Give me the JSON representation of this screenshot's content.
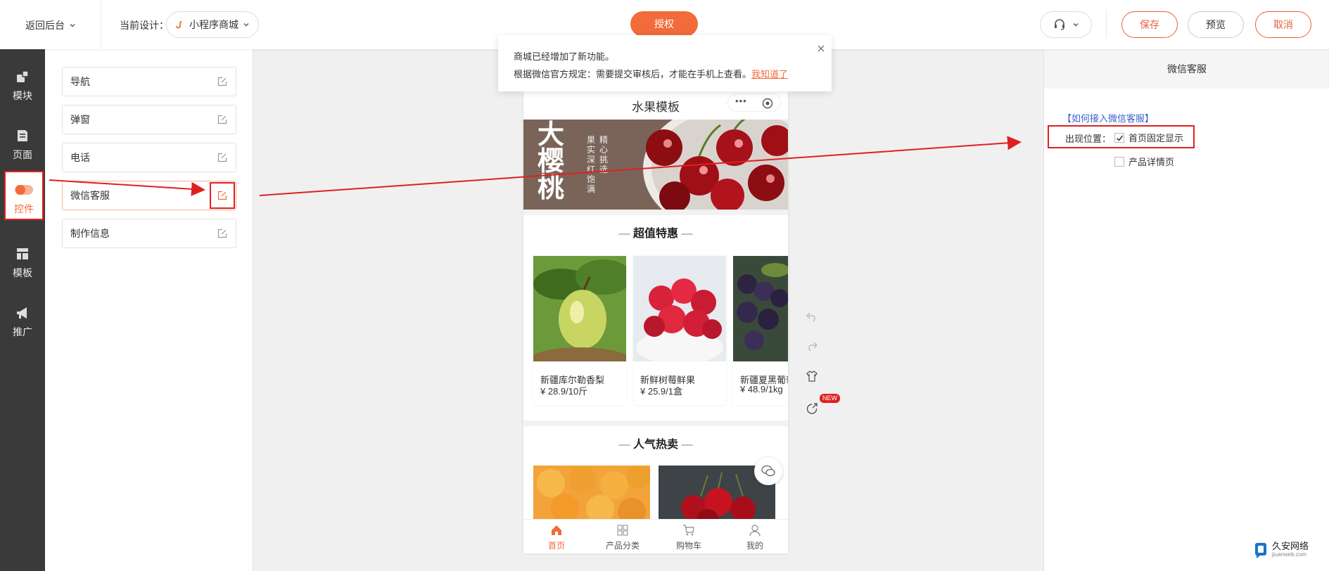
{
  "topbar": {
    "back_label": "返回后台",
    "current_design_label": "当前设计：",
    "design_name": "小程序商城",
    "authorize_label": "授权",
    "save_label": "保存",
    "preview_label": "预览",
    "cancel_label": "取消"
  },
  "notice": {
    "line1": "商城已经增加了新功能。",
    "line2": "根据微信官方规定：需要提交审核后，才能在手机上查看。",
    "link": "我知道了"
  },
  "leftnav": {
    "items": [
      {
        "label": "模块"
      },
      {
        "label": "页面"
      },
      {
        "label": "控件"
      },
      {
        "label": "模板"
      },
      {
        "label": "推广"
      }
    ]
  },
  "widgets": {
    "items": [
      {
        "label": "导航"
      },
      {
        "label": "弹窗"
      },
      {
        "label": "电话"
      },
      {
        "label": "微信客服"
      },
      {
        "label": "制作信息"
      }
    ]
  },
  "phone": {
    "title": "水果模板",
    "banner_big": "大樱桃",
    "banner_small_1": "精心挑选",
    "banner_small_2": "果实深红饱满",
    "section1": "超值特惠",
    "products": [
      {
        "name": "新疆库尔勒香梨",
        "price": "¥ 28.9/10斤"
      },
      {
        "name": "新鲜树莓鲜果",
        "price": "¥ 25.9/1盒"
      },
      {
        "name": "新疆夏黑葡萄",
        "price": "¥ 48.9/1kg"
      }
    ],
    "section2": "人气热卖",
    "tabs": [
      {
        "label": "首页"
      },
      {
        "label": "产品分类"
      },
      {
        "label": "购物车"
      },
      {
        "label": "我的"
      }
    ]
  },
  "tools": {
    "new_badge": "NEW"
  },
  "rightpanel": {
    "title": "微信客服",
    "help_link": "【如何接入微信客服】",
    "position_label": "出现位置：",
    "option1": "首页固定显示",
    "option1_checked": true,
    "option2": "产品详情页",
    "option2_checked": false
  },
  "watermark": {
    "name": "久安网络",
    "domain": "jiuanweb.com"
  },
  "colors": {
    "accent": "#f26b3a",
    "highlight": "#e02020",
    "link": "#3a5fcd",
    "nav_bg": "#3a3a3a"
  }
}
